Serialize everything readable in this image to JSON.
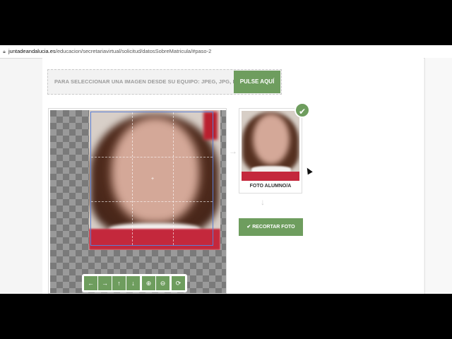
{
  "browser": {
    "url_host": "juntadeandalucia.es",
    "url_path": "/educacion/secretariavirtual/solicitud/datosSobreMatricula/#paso-2",
    "lock_icon": "lock-icon"
  },
  "upload": {
    "instruction": "PARA SELECCIONAR UNA IMAGEN DESDE SU EQUIPO: JPEG, JPG, PNG",
    "button_label": "PULSE AQUÍ"
  },
  "editor": {
    "tools": [
      {
        "name": "move-left",
        "glyph": "←"
      },
      {
        "name": "move-right",
        "glyph": "→"
      },
      {
        "name": "move-up",
        "glyph": "↑"
      },
      {
        "name": "move-down",
        "glyph": "↓"
      },
      {
        "name": "zoom-in",
        "glyph": "⊕"
      },
      {
        "name": "zoom-out",
        "glyph": "⊖"
      },
      {
        "name": "reset",
        "glyph": "⟳"
      }
    ]
  },
  "preview": {
    "label": "FOTO ALUMNO/A",
    "status_glyph": "✔"
  },
  "actions": {
    "crop_label": "✔ RECORTAR FOTO"
  },
  "colors": {
    "accent": "#6e9d5e",
    "crop_border": "#5a7fd6"
  }
}
